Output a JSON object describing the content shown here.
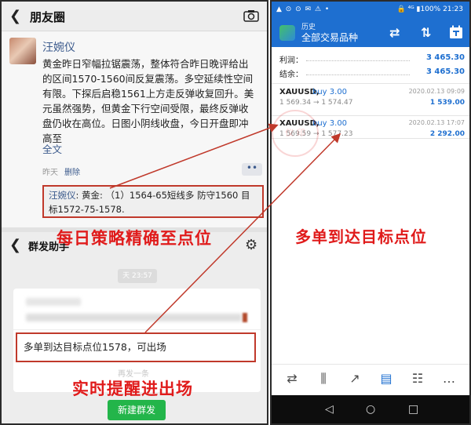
{
  "left": {
    "header": {
      "back_icon": "chevron-left-icon",
      "title": "朋友圈",
      "camera_icon": "camera-icon"
    },
    "post": {
      "author": "汪婉仪",
      "text": "黄金昨日窄幅拉锯震荡，整体符合昨日晚评给出的区间1570-1560间反复震荡。多空延续性空间有限。下探后启稳1561上方走反弹收复回升。美元虽然强势，但黄金下行空间受限，最终反弹收盘仍收在高位。日图小阴线收盘，今日开盘即冲高至",
      "more": "全文",
      "time": "昨天",
      "delete": "删除",
      "dots": "••",
      "comment_name": "汪婉仪",
      "comment_text": ": 黄金: （1）1564-65短线多 防守1560  目标1572-75-1578."
    },
    "group": {
      "title": "群发助手",
      "headline": "每日策略精确至点位",
      "time_pill": "天 23:57",
      "message": "多单到达目标点位1578，可出场",
      "resend": "再发一条",
      "headline2": "实时提醒进出场",
      "new_group_button": "新建群发"
    }
  },
  "right": {
    "status": {
      "left": "▲ ⊙ ⊙ ✉ ⚠ •",
      "right": "🔒 ⁴ᴳ ▮100% 21:23"
    },
    "appbar": {
      "subtitle": "历史",
      "title": "全部交易品种",
      "icons": [
        "sort-currency-icon",
        "sort-arrows-icon",
        "calendar-icon"
      ]
    },
    "summary": [
      {
        "label": "利润：",
        "value": "3 465.30"
      },
      {
        "label": "结余：",
        "value": "3 465.30"
      }
    ],
    "trades": [
      {
        "symbol": "XAUUSD,",
        "side": "buy 3.00",
        "date": "2020.02.13 09:09",
        "prices": "1 569.34 → 1 574.47",
        "profit": "1 539.00"
      },
      {
        "symbol": "XAUUSD,",
        "side": "buy 3.00",
        "date": "2020.02.13 17:07",
        "prices": "1 569.59 → 1 577.23",
        "profit": "2 292.00"
      }
    ],
    "callout": "多单到达目标点位",
    "watermark": "仪 印",
    "colors": {
      "accent": "#1e6fd0",
      "callout": "#e01b1b",
      "wechat_green": "#23b54a"
    }
  }
}
